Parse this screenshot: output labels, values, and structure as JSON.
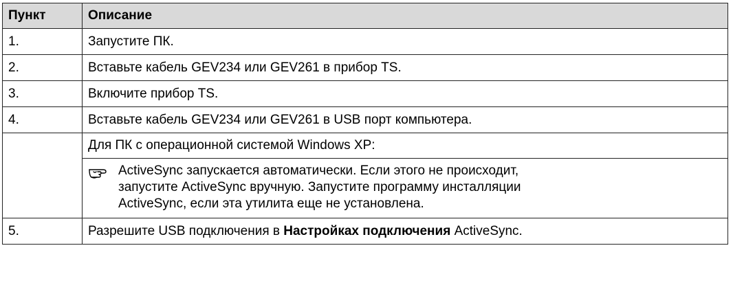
{
  "header": {
    "col1": "Пункт",
    "col2": "Описание"
  },
  "rows": [
    {
      "num": "1.",
      "text": "Запустите ПК."
    },
    {
      "num": "2.",
      "text": "Вставьте кабель GEV234 или GEV261 в прибор TS."
    },
    {
      "num": "3.",
      "text": "Включите прибор TS."
    },
    {
      "num": "4.",
      "text": "Вставьте кабель GEV234 или GEV261 в USB порт компьютера."
    }
  ],
  "note_block": {
    "subheading": "Для ПК с операционной системой Windows XP:",
    "icon": "pointing-hand-icon",
    "text_lines": [
      "ActiveSync запускается автоматически. Если этого не происходит,",
      "запустите ActiveSync вручную. Запустите программу инсталляции",
      "ActiveSync, если эта утилита еще не установлена."
    ]
  },
  "last_row": {
    "num": "5.",
    "text_before": "Разрешите USB подключения в ",
    "text_bold": "Настройках подключения",
    "text_after": " ActiveSync."
  }
}
